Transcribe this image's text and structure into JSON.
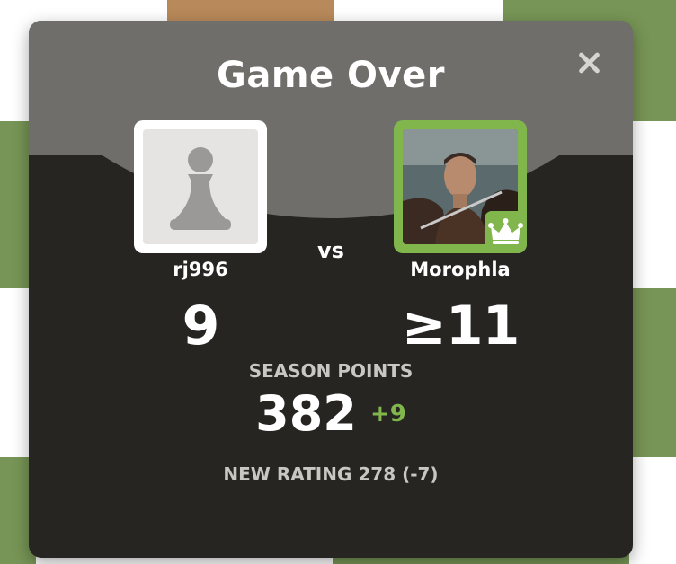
{
  "modal": {
    "title": "Game Over",
    "close_icon": "close-icon"
  },
  "players": [
    {
      "name": "rj996",
      "score": "9",
      "avatar_icon": "pawn-icon"
    },
    {
      "name": "Morophla",
      "score": "≥11",
      "avatar_icon": "user-photo",
      "badge_icon": "crown-icon"
    }
  ],
  "vs_label": "vs",
  "season": {
    "label": "SEASON POINTS",
    "points": "382",
    "delta": "+9"
  },
  "rating": {
    "text": "NEW RATING 278 (-7)"
  },
  "colors": {
    "accent_green": "#81b64c",
    "modal_bg": "#262522",
    "modal_header": "#6f6e6b"
  }
}
